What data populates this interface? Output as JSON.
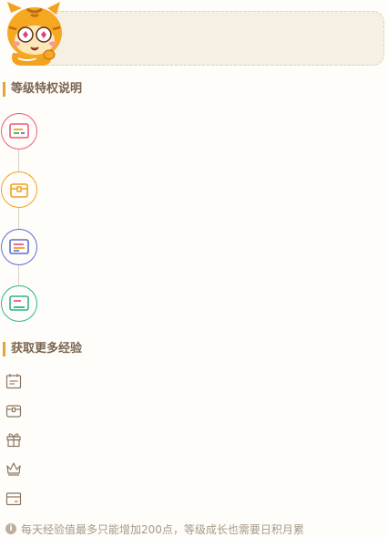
{
  "banner": {
    "mascot_icon": "tiger-mascot-icon"
  },
  "sections": {
    "privileges_title": "等级特权说明",
    "experience_title": "获取更多经验"
  },
  "privileges": [
    {
      "icon": "ticket-icon",
      "color": "#ee5a7a"
    },
    {
      "icon": "treasure-chest-icon",
      "color": "#f0a020"
    },
    {
      "icon": "coupon-icon",
      "color": "#5b6fd6"
    },
    {
      "icon": "card-icon",
      "color": "#2bb58a"
    }
  ],
  "experience_items": [
    {
      "icon": "calendar-icon"
    },
    {
      "icon": "treasure-box-icon"
    },
    {
      "icon": "gift-icon"
    },
    {
      "icon": "crown-icon"
    },
    {
      "icon": "wallet-icon"
    }
  ],
  "footer": {
    "info_icon": "info-icon",
    "info_glyph": "i",
    "note": "每天经验值最多只能增加200点，等级成长也需要日积月累"
  }
}
